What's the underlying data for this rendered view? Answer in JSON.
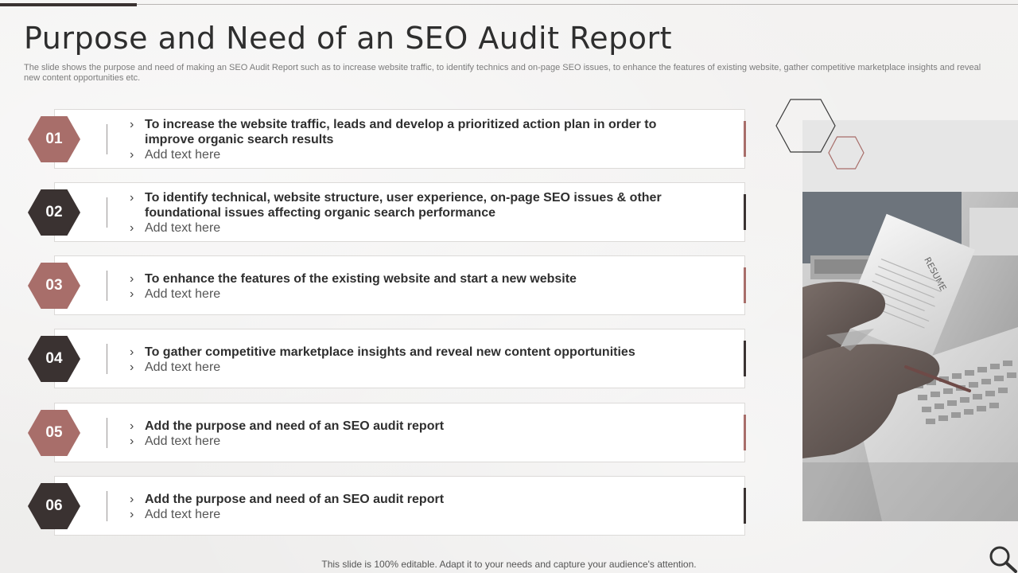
{
  "slide": {
    "title": "Purpose and Need of an SEO Audit Report",
    "subtitle": "The slide shows the purpose and need of making an SEO Audit Report such as to increase website traffic, to identify technics and on-page SEO issues, to enhance the features of existing website, gather competitive marketplace insights and reveal new content opportunities etc.",
    "footer": "This slide is 100% editable. Adapt it to your needs and capture your audience's attention."
  },
  "colors": {
    "rose": "#a86e6a",
    "dark": "#3a3231",
    "background": "#f1f0ef"
  },
  "items": [
    {
      "number": "01",
      "headline": "To increase the website traffic, leads and develop a prioritized action plan in order to improve organic search results",
      "note": "Add text here",
      "color": "#a86e6a"
    },
    {
      "number": "02",
      "headline": "To identify technical, website structure, user experience, on-page SEO issues & other foundational issues affecting organic search performance",
      "note": "Add text here",
      "color": "#3a3231"
    },
    {
      "number": "03",
      "headline": "To enhance the features of the existing website and start a new website",
      "note": "Add text here",
      "color": "#a86e6a"
    },
    {
      "number": "04",
      "headline": "To gather competitive marketplace insights and reveal new content opportunities",
      "note": "Add text here",
      "color": "#3a3231"
    },
    {
      "number": "05",
      "headline": "Add the purpose and need of an SEO audit report",
      "note": "Add text here",
      "color": "#a86e6a"
    },
    {
      "number": "06",
      "headline": "Add the purpose and need of an SEO audit report",
      "note": "Add text here",
      "color": "#3a3231"
    }
  ],
  "photo": {
    "document_label": "RESUME"
  },
  "icons": {
    "bullet": "chevron-right-icon",
    "corner": "search-icon"
  }
}
